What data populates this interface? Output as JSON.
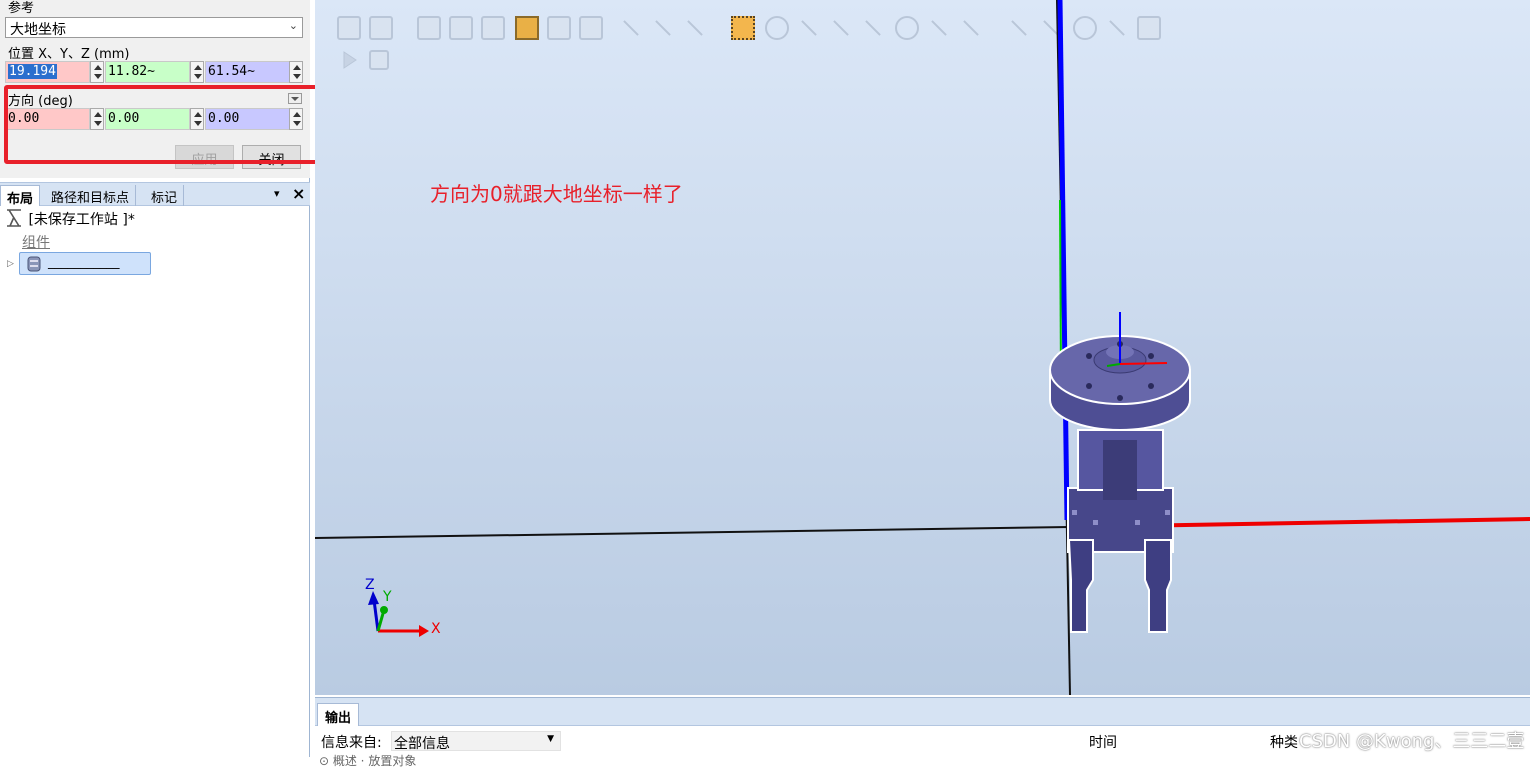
{
  "properties": {
    "reference_label": "参考",
    "reference_value": "大地坐标",
    "position_label": "位置 X、Y、Z (mm)",
    "position": {
      "x": "19.194",
      "y": "11.82~",
      "z": "61.54~"
    },
    "orientation_label": "方向 (deg)",
    "orientation": {
      "x": "0.00",
      "y": "0.00",
      "z": "0.00"
    },
    "apply_label": "应用",
    "close_label": "关闭"
  },
  "tabs": [
    "布局",
    "路径和目标点",
    "标记"
  ],
  "tree": {
    "station": "[未保存工作站 ]*",
    "group": "组件",
    "component": "___________"
  },
  "annotation": "方向为0就跟大地坐标一样了",
  "axes": {
    "x": "X",
    "y": "Y",
    "z": "Z"
  },
  "output": {
    "tab": "输出",
    "source_label": "信息来自:",
    "source_value": "全部信息",
    "col_time": "时间",
    "col_type": "种类",
    "watermark": "CSDN @Kwong、三三二壹",
    "partial_row": "⊙ 概述 · 放置对象"
  },
  "colors": {
    "highlight": "#e8202a",
    "robot_body": "#4a4a8c",
    "x_axis": "#ff0000",
    "y_axis": "#00cc00",
    "z_axis": "#0000ff"
  }
}
